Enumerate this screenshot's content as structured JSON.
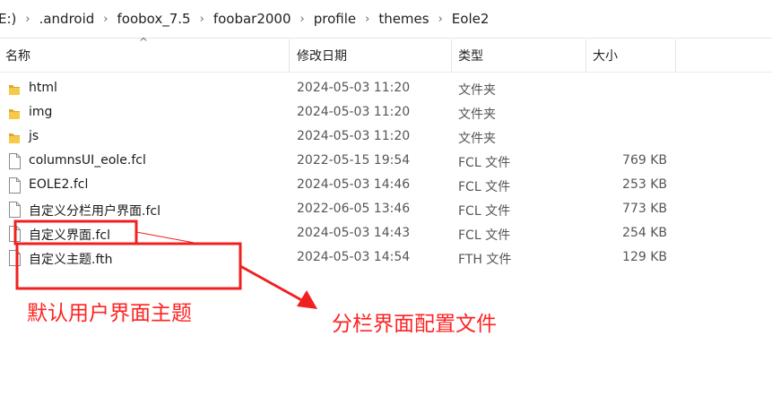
{
  "breadcrumb": {
    "items": [
      "E:)",
      ".android",
      "foobox_7.5",
      "foobar2000",
      "profile",
      "themes",
      "Eole2"
    ],
    "separator": "›"
  },
  "columns": {
    "name": "名称",
    "date": "修改日期",
    "type": "类型",
    "size": "大小",
    "sort_indicator": "^"
  },
  "files": [
    {
      "name": "html",
      "date": "2024-05-03 11:20",
      "type": "文件夹",
      "size": "",
      "icon": "folder-icon"
    },
    {
      "name": "img",
      "date": "2024-05-03 11:20",
      "type": "文件夹",
      "size": "",
      "icon": "folder-icon"
    },
    {
      "name": "js",
      "date": "2024-05-03 11:20",
      "type": "文件夹",
      "size": "",
      "icon": "folder-icon"
    },
    {
      "name": "columnsUI_eole.fcl",
      "date": "2022-05-15 19:54",
      "type": "FCL 文件",
      "size": "769 KB",
      "icon": "file-icon"
    },
    {
      "name": "EOLE2.fcl",
      "date": "2024-05-03 14:46",
      "type": "FCL 文件",
      "size": "253 KB",
      "icon": "file-icon"
    },
    {
      "name": "自定义分栏用户界面.fcl",
      "date": "2022-06-05 13:46",
      "type": "FCL 文件",
      "size": "773 KB",
      "icon": "file-icon"
    },
    {
      "name": "自定义界面.fcl",
      "date": "2024-05-03 14:43",
      "type": "FCL 文件",
      "size": "254 KB",
      "icon": "file-icon"
    },
    {
      "name": "自定义主题.fth",
      "date": "2024-05-03 14:54",
      "type": "FTH 文件",
      "size": "129 KB",
      "icon": "file-icon"
    }
  ],
  "annotations": {
    "left_label": "默认用户界面主题",
    "right_label": "分栏界面配置文件",
    "color": "#f02020"
  },
  "colors": {
    "folder": "#f7c948",
    "annotation": "#f02020"
  }
}
